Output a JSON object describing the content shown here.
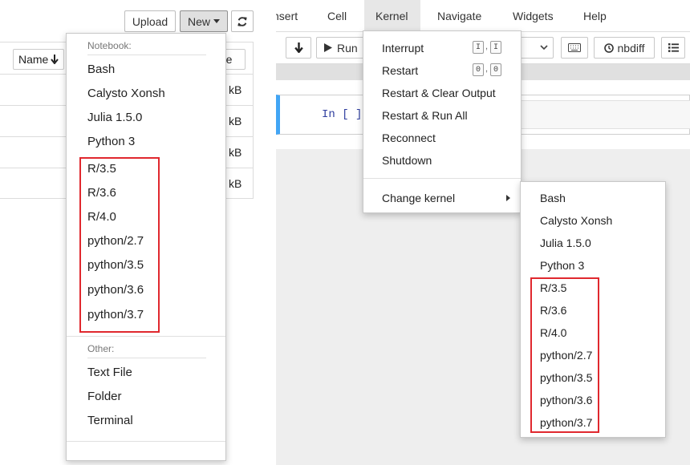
{
  "left": {
    "upload_label": "Upload",
    "new_label": "New",
    "refresh_icon": "refresh-icon",
    "list": {
      "name_header": "Name",
      "size_header": "ze",
      "rows": [
        {
          "size": "kB"
        },
        {
          "size": "kB"
        },
        {
          "size": "kB"
        },
        {
          "size": "kB"
        }
      ]
    },
    "new_menu": {
      "notebook_header": "Notebook:",
      "kernels": [
        "Bash",
        "Calysto Xonsh",
        "Julia 1.5.0",
        "Python 3",
        "R/3.5",
        "R/3.6",
        "R/4.0",
        "python/2.7",
        "python/3.5",
        "python/3.6",
        "python/3.7"
      ],
      "other_header": "Other:",
      "other_items": [
        "Text File",
        "Folder",
        "Terminal"
      ]
    }
  },
  "right": {
    "menubar": [
      "nsert",
      "Cell",
      "Kernel",
      "Navigate",
      "Widgets",
      "Help"
    ],
    "toolbar": {
      "run_label": "Run",
      "nbdiff_label": "nbdiff"
    },
    "cell_prompt": "In [ ]",
    "kernel_menu": {
      "interrupt": "Interrupt",
      "interrupt_keys": [
        "I",
        "I"
      ],
      "restart": "Restart",
      "restart_keys": [
        "0",
        "0"
      ],
      "key_separator": ",",
      "restart_clear": "Restart & Clear Output",
      "restart_run_all": "Restart & Run All",
      "reconnect": "Reconnect",
      "shutdown": "Shutdown",
      "change_kernel": "Change kernel"
    },
    "kernel_submenu": [
      "Bash",
      "Calysto Xonsh",
      "Julia 1.5.0",
      "Python 3",
      "R/3.5",
      "R/3.6",
      "R/4.0",
      "python/2.7",
      "python/3.5",
      "python/3.6",
      "python/3.7"
    ]
  },
  "colors": {
    "highlight_box": "#e0282e",
    "cell_border": "#42a5f5",
    "prompt": "#303f9f"
  }
}
